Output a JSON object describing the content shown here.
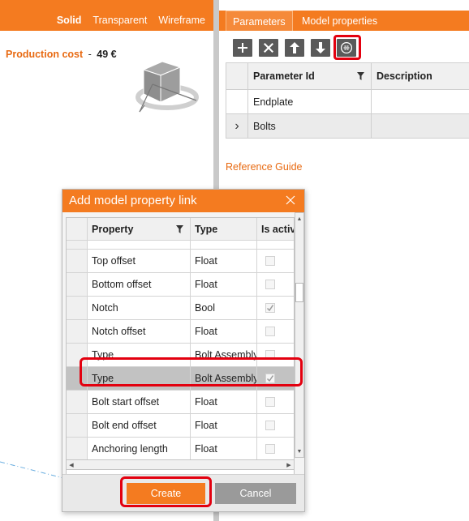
{
  "viewport": {
    "view_modes": [
      "Solid",
      "Transparent",
      "Wireframe"
    ],
    "active_view_mode": "Solid",
    "production_cost_label": "Production cost",
    "production_cost_separator": "-",
    "production_cost_value": "49 €"
  },
  "panel": {
    "tabs": [
      {
        "label": "Parameters",
        "active": true
      },
      {
        "label": "Model properties",
        "active": false
      }
    ],
    "toolbar": [
      "add-icon",
      "delete-icon",
      "move-up-icon",
      "move-down-icon",
      "link-icon"
    ],
    "grid": {
      "columns": [
        "Parameter Id",
        "Description"
      ],
      "rows": [
        {
          "expander": "",
          "parameter_id": "Endplate",
          "description": ""
        },
        {
          "expander": "›",
          "parameter_id": "Bolts",
          "description": ""
        }
      ]
    },
    "reference_link": "Reference Guide"
  },
  "dialog": {
    "title": "Add model property link",
    "columns": [
      "Property",
      "Type",
      "Is activ"
    ],
    "rows": [
      {
        "property": "Top offset",
        "type": "Float",
        "active": false,
        "selected": false
      },
      {
        "property": "Bottom offset",
        "type": "Float",
        "active": false,
        "selected": false
      },
      {
        "property": "Notch",
        "type": "Bool",
        "active": true,
        "selected": false
      },
      {
        "property": "Notch offset",
        "type": "Float",
        "active": false,
        "selected": false
      },
      {
        "property": "Type",
        "type": "Bolt Assembly",
        "active": false,
        "selected": false
      },
      {
        "property": "Type",
        "type": "Bolt Assembly",
        "active": true,
        "selected": true
      },
      {
        "property": "Bolt start offset",
        "type": "Float",
        "active": false,
        "selected": false
      },
      {
        "property": "Bolt end offset",
        "type": "Float",
        "active": false,
        "selected": false
      },
      {
        "property": "Anchoring length",
        "type": "Float",
        "active": false,
        "selected": false
      }
    ],
    "create_label": "Create",
    "cancel_label": "Cancel"
  },
  "colors": {
    "accent": "#f47b20",
    "highlight": "#e3000f",
    "toolbar_button": "#5a5a5a",
    "selected_row": "#c2c2c2"
  }
}
